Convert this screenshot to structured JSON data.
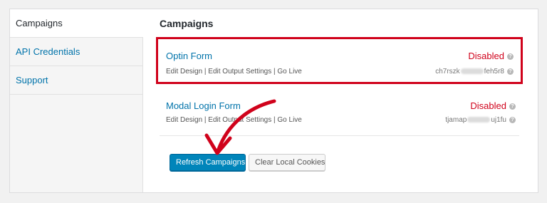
{
  "sidebar": {
    "items": [
      {
        "label": "Campaigns"
      },
      {
        "label": "API Credentials"
      },
      {
        "label": "Support"
      }
    ]
  },
  "main": {
    "title": "Campaigns",
    "campaigns": [
      {
        "name": "Optin Form",
        "links": [
          "Edit Design",
          "Edit Output Settings",
          "Go Live"
        ],
        "status": "Disabled",
        "id_start": "ch7rszk",
        "id_end": "feh5r8"
      },
      {
        "name": "Modal Login Form",
        "links": [
          "Edit Design",
          "Edit Output Settings",
          "Go Live"
        ],
        "status": "Disabled",
        "id_start": "tjamap",
        "id_end": "uj1fu"
      }
    ],
    "buttons": {
      "refresh": "Refresh Campaigns",
      "clear": "Clear Local Cookies"
    }
  },
  "colors": {
    "link": "#0073aa",
    "disabled": "#d0021b",
    "highlight_box": "#d0021b",
    "arrow": "#d0021b",
    "primary_button": "#0085ba"
  },
  "icons": [
    "help-icon",
    "arrow-annotation"
  ]
}
